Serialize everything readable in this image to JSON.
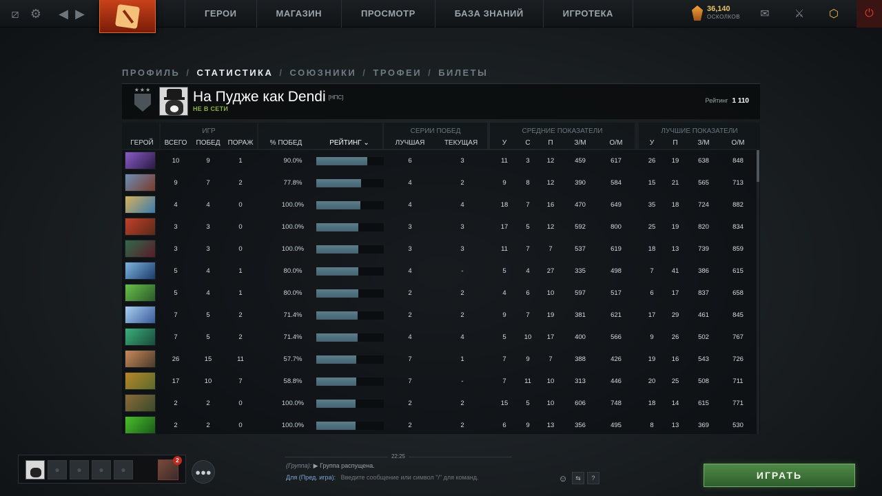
{
  "topbar": {
    "nav": [
      "ГЕРОИ",
      "МАГАЗИН",
      "ПРОСМОТР",
      "БАЗА ЗНАНИЙ",
      "ИГРОТЕКА"
    ],
    "shards_value": "36,140",
    "shards_label": "ОСКОЛКОВ"
  },
  "crumbs": [
    "ПРОФИЛЬ",
    "СТАТИСТИКА",
    "СОЮЗНИКИ",
    "ТРОФЕИ",
    "БИЛЕТЫ"
  ],
  "crumb_sep": "/",
  "profile": {
    "name": "На Пудже как Dendi",
    "tag": "[НПС]",
    "status": "НЕ В СЕТИ",
    "rating_label": "Рейтинг",
    "rating_value": "1 110"
  },
  "headers": {
    "groups": {
      "games": "ИГР",
      "streaks": "СЕРИИ ПОБЕД",
      "avg": "СРЕДНИЕ ПОКАЗАТЕЛИ",
      "best": "ЛУЧШИЕ ПОКАЗАТЕЛИ"
    },
    "hero": "ГЕРОЙ",
    "total": "ВСЕГО",
    "wins": "ПОБЕД",
    "losses": "ПОРАЖ",
    "winrate": "% ПОБЕД",
    "rating": "РЕЙТИНГ ⌄",
    "best_streak": "ЛУЧШАЯ",
    "cur_streak": "ТЕКУЩАЯ",
    "avg_k": "У",
    "avg_d": "С",
    "avg_a": "П",
    "avg_gpm": "З/М",
    "avg_xpm": "О/М",
    "best_k": "У",
    "best_a": "П",
    "best_gpm": "З/М",
    "best_xpm": "О/М"
  },
  "rows": [
    {
      "hero_color": [
        "#8a5cc8",
        "#2a1a44"
      ],
      "total": "10",
      "wins": "9",
      "losses": "1",
      "winrate": "90.0%",
      "rating_fill": 0.75,
      "best_streak": "6",
      "cur_streak": "3",
      "ak": "11",
      "ad": "3",
      "aa": "12",
      "agpm": "459",
      "axpm": "617",
      "bk": "26",
      "ba": "19",
      "bgpm": "638",
      "bxpm": "848"
    },
    {
      "hero_color": [
        "#6b8fb5",
        "#7a3a2a"
      ],
      "total": "9",
      "wins": "7",
      "losses": "2",
      "winrate": "77.8%",
      "rating_fill": 0.66,
      "best_streak": "4",
      "cur_streak": "2",
      "ak": "9",
      "ad": "8",
      "aa": "12",
      "agpm": "390",
      "axpm": "584",
      "bk": "15",
      "ba": "21",
      "bgpm": "565",
      "bxpm": "713"
    },
    {
      "hero_color": [
        "#d6b25a",
        "#3a7ab0"
      ],
      "total": "4",
      "wins": "4",
      "losses": "0",
      "winrate": "100.0%",
      "rating_fill": 0.65,
      "best_streak": "4",
      "cur_streak": "4",
      "ak": "18",
      "ad": "7",
      "aa": "16",
      "agpm": "470",
      "axpm": "649",
      "bk": "35",
      "ba": "18",
      "bgpm": "724",
      "bxpm": "882"
    },
    {
      "hero_color": [
        "#c2402a",
        "#5a2a18"
      ],
      "total": "3",
      "wins": "3",
      "losses": "0",
      "winrate": "100.0%",
      "rating_fill": 0.62,
      "best_streak": "3",
      "cur_streak": "3",
      "ak": "17",
      "ad": "5",
      "aa": "12",
      "agpm": "592",
      "axpm": "800",
      "bk": "25",
      "ba": "19",
      "bgpm": "820",
      "bxpm": "834"
    },
    {
      "hero_color": [
        "#2e6a4a",
        "#5a1a2a"
      ],
      "total": "3",
      "wins": "3",
      "losses": "0",
      "winrate": "100.0%",
      "rating_fill": 0.62,
      "best_streak": "3",
      "cur_streak": "3",
      "ak": "11",
      "ad": "7",
      "aa": "7",
      "agpm": "537",
      "axpm": "619",
      "bk": "18",
      "ba": "13",
      "bgpm": "739",
      "bxpm": "859"
    },
    {
      "hero_color": [
        "#7fb4e0",
        "#1a3a6a"
      ],
      "total": "5",
      "wins": "4",
      "losses": "1",
      "winrate": "80.0%",
      "rating_fill": 0.62,
      "best_streak": "4",
      "cur_streak": "-",
      "ak": "5",
      "ad": "4",
      "aa": "27",
      "agpm": "335",
      "axpm": "498",
      "bk": "7",
      "ba": "41",
      "bgpm": "386",
      "bxpm": "615"
    },
    {
      "hero_color": [
        "#6ac04a",
        "#2a5a2a"
      ],
      "total": "5",
      "wins": "4",
      "losses": "1",
      "winrate": "80.0%",
      "rating_fill": 0.62,
      "best_streak": "2",
      "cur_streak": "2",
      "ak": "4",
      "ad": "6",
      "aa": "10",
      "agpm": "597",
      "axpm": "517",
      "bk": "6",
      "ba": "17",
      "bgpm": "837",
      "bxpm": "658"
    },
    {
      "hero_color": [
        "#a8d0f0",
        "#3a5a9a"
      ],
      "total": "7",
      "wins": "5",
      "losses": "2",
      "winrate": "71.4%",
      "rating_fill": 0.61,
      "best_streak": "2",
      "cur_streak": "2",
      "ak": "9",
      "ad": "7",
      "aa": "19",
      "agpm": "381",
      "axpm": "621",
      "bk": "17",
      "ba": "29",
      "bgpm": "461",
      "bxpm": "845"
    },
    {
      "hero_color": [
        "#3ab07a",
        "#1a4a3a"
      ],
      "total": "7",
      "wins": "5",
      "losses": "2",
      "winrate": "71.4%",
      "rating_fill": 0.61,
      "best_streak": "4",
      "cur_streak": "4",
      "ak": "5",
      "ad": "10",
      "aa": "17",
      "agpm": "400",
      "axpm": "566",
      "bk": "9",
      "ba": "26",
      "bgpm": "502",
      "bxpm": "767"
    },
    {
      "hero_color": [
        "#c88a5a",
        "#4a3a2a"
      ],
      "total": "26",
      "wins": "15",
      "losses": "11",
      "winrate": "57.7%",
      "rating_fill": 0.59,
      "best_streak": "7",
      "cur_streak": "1",
      "ak": "7",
      "ad": "9",
      "aa": "7",
      "agpm": "388",
      "axpm": "426",
      "bk": "19",
      "ba": "16",
      "bgpm": "543",
      "bxpm": "726"
    },
    {
      "hero_color": [
        "#b8862a",
        "#5a6a2a"
      ],
      "total": "17",
      "wins": "10",
      "losses": "7",
      "winrate": "58.8%",
      "rating_fill": 0.59,
      "best_streak": "7",
      "cur_streak": "-",
      "ak": "7",
      "ad": "11",
      "aa": "10",
      "agpm": "313",
      "axpm": "446",
      "bk": "20",
      "ba": "25",
      "bgpm": "508",
      "bxpm": "711"
    },
    {
      "hero_color": [
        "#8a6a3a",
        "#3a4a2a"
      ],
      "total": "2",
      "wins": "2",
      "losses": "0",
      "winrate": "100.0%",
      "rating_fill": 0.58,
      "best_streak": "2",
      "cur_streak": "2",
      "ak": "15",
      "ad": "5",
      "aa": "10",
      "agpm": "606",
      "axpm": "748",
      "bk": "18",
      "ba": "14",
      "bgpm": "615",
      "bxpm": "771"
    },
    {
      "hero_color": [
        "#4ac02a",
        "#1a5a1a"
      ],
      "total": "2",
      "wins": "2",
      "losses": "0",
      "winrate": "100.0%",
      "rating_fill": 0.58,
      "best_streak": "2",
      "cur_streak": "2",
      "ak": "6",
      "ad": "9",
      "aa": "13",
      "agpm": "356",
      "axpm": "495",
      "bk": "8",
      "ba": "13",
      "bgpm": "369",
      "bxpm": "530"
    }
  ],
  "party": {
    "badge": "2"
  },
  "chat": {
    "time": "22:25",
    "group_tag": "(Группа):",
    "arrow": "▶",
    "message": "Группа распущена.",
    "channel": "Для (Пред. игра):",
    "placeholder": "Введите сообщение или символ \"/\" для команд."
  },
  "chat_icons": [
    "☺",
    "⇆",
    "?"
  ],
  "play_label": "ИГРАТЬ"
}
